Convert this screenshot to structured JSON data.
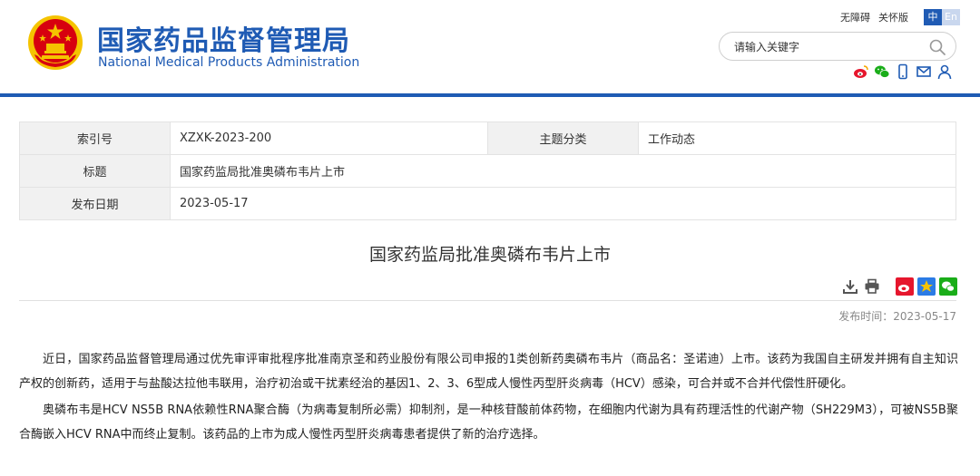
{
  "header": {
    "title_cn": "国家药品监督管理局",
    "title_en": "National Medical Products Administration",
    "accessibility_label": "无障碍",
    "care_label": "关怀版",
    "lang_zh": "中",
    "lang_en": "En",
    "search_placeholder": "请输入关键字",
    "social_icons": [
      "weibo-icon",
      "wechat-icon",
      "mobile-icon",
      "mail-icon",
      "user-icon"
    ]
  },
  "info_table": {
    "index_label": "索引号",
    "index_value": "XZXK-2023-200",
    "category_label": "主题分类",
    "category_value": "工作动态",
    "title_label": "标题",
    "title_value": "国家药监局批准奥磷布韦片上市",
    "date_label": "发布日期",
    "date_value": "2023-05-17"
  },
  "article": {
    "title": "国家药监局批准奥磷布韦片上市",
    "publish_time": "发布时间：2023-05-17",
    "paragraphs": [
      "近日，国家药品监督管理局通过优先审评审批程序批准南京圣和药业股份有限公司申报的1类创新药奥磷布韦片（商品名：圣诺迪）上市。该药为我国自主研发并拥有自主知识产权的创新药，适用于与盐酸达拉他韦联用，治疗初治或干扰素经治的基因1、2、3、6型成人慢性丙型肝炎病毒（HCV）感染，可合并或不合并代偿性肝硬化。",
      "奥磷布韦是HCV NS5B RNA依赖性RNA聚合酶（为病毒复制所必需）抑制剂，是一种核苷酸前体药物，在细胞内代谢为具有药理活性的代谢产物（SH229M3），可被NS5B聚合酶嵌入HCV RNA中而终止复制。该药品的上市为成人慢性丙型肝炎病毒患者提供了新的治疗选择。"
    ]
  },
  "colors": {
    "brand_blue": "#1f5bb4",
    "emblem_red": "#d7000f",
    "emblem_gold": "#f5c400"
  }
}
